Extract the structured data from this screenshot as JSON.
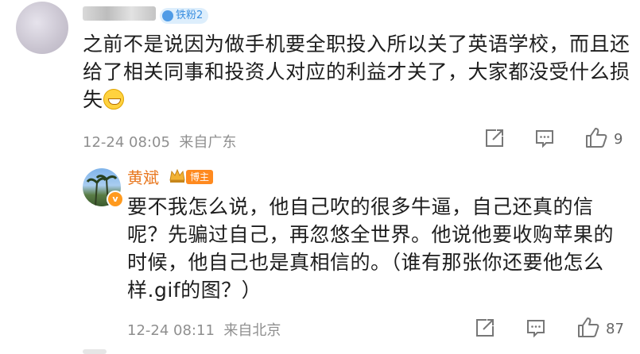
{
  "comment": {
    "fan_badge": "铁粉2",
    "text": "之前不是说因为做手机要全职投入所以关了英语学校，而且还给了相关同事和投资人对应的利益才关了，大家都没受什么损失",
    "emoji": "grinning-emoji",
    "time": "12-24 08:05",
    "location": "来自广东",
    "like_count": "9"
  },
  "reply": {
    "author": "黄斌",
    "role_badge": "博主",
    "verified_badge": "v",
    "text": "要不我怎么说，他自己吹的很多牛逼，自己还真的信呢？先骗过自己，再忽悠全世界。他说他要收购苹果的时候，他自己也是真相信的。（谁有那张你还要他怎么样.gif的图？）",
    "time": "12-24 08:11",
    "location": "来自北京",
    "like_count": "87"
  },
  "icons": [
    "share-icon",
    "comment-icon",
    "like-icon",
    "crown-icon"
  ],
  "colors": {
    "author": "#e8761d",
    "badge": "#ff8a1f",
    "fan_badge": "#3b8fe0",
    "meta": "#8f8f8f"
  }
}
